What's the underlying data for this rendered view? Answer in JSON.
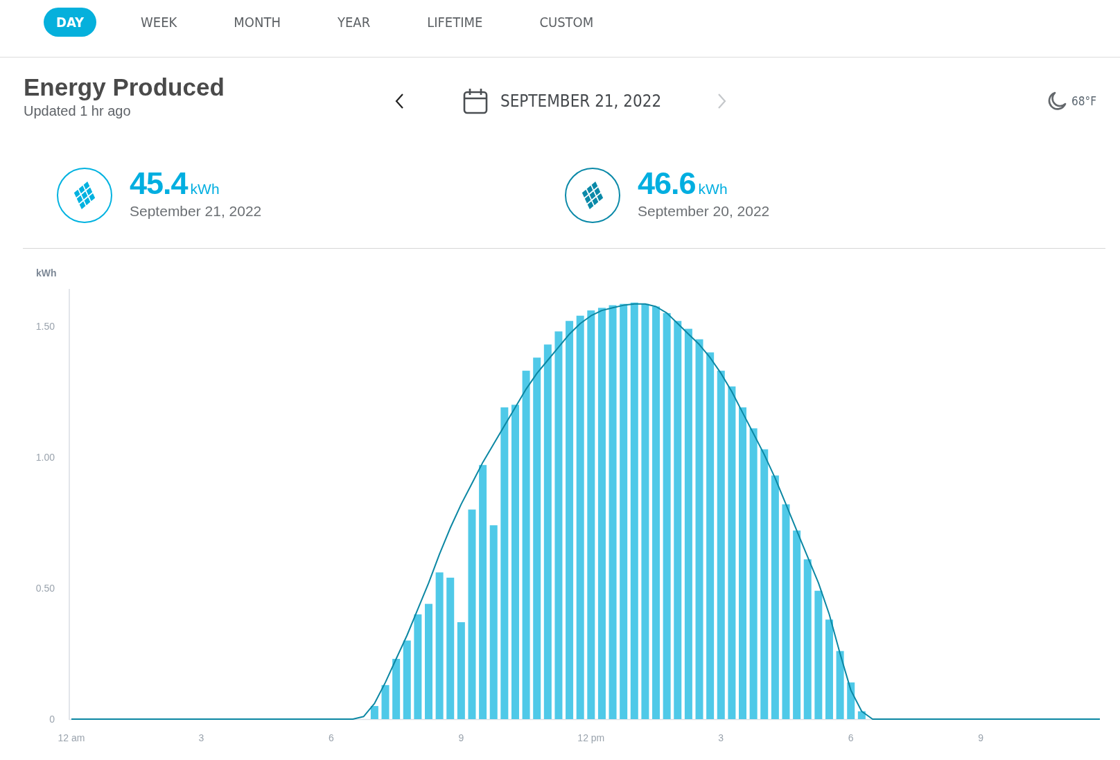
{
  "tabs": [
    {
      "label": "DAY",
      "selected": true
    },
    {
      "label": "WEEK",
      "selected": false
    },
    {
      "label": "MONTH",
      "selected": false
    },
    {
      "label": "YEAR",
      "selected": false
    },
    {
      "label": "LIFETIME",
      "selected": false
    },
    {
      "label": "CUSTOM",
      "selected": false
    }
  ],
  "header": {
    "title": "Energy Produced",
    "updated": "Updated 1 hr ago",
    "date": "SEPTEMBER 21, 2022",
    "previous": {
      "disabled": false
    },
    "next": {
      "disabled": true
    },
    "weather": "68°F"
  },
  "stats": [
    {
      "value": "45.4",
      "unit": "kWh",
      "date": "September 21, 2022",
      "color": "#00b2e0"
    },
    {
      "value": "46.6",
      "unit": "kWh",
      "date": "September 20, 2022",
      "color": "#0a89a8"
    }
  ],
  "chart_data": {
    "type": "bar",
    "ylabel": "kWh",
    "ylim": [
      0,
      1.6
    ],
    "yticks": [
      {
        "value": 0,
        "label": "0"
      },
      {
        "value": 0.5,
        "label": "0.50"
      },
      {
        "value": 1,
        "label": "1.00"
      },
      {
        "value": 1.5,
        "label": "1.50"
      }
    ],
    "categories": [
      "12 am",
      null,
      null,
      null,
      null,
      null,
      null,
      null,
      null,
      null,
      null,
      null,
      "3",
      null,
      null,
      null,
      null,
      null,
      null,
      null,
      null,
      null,
      null,
      null,
      "6",
      null,
      null,
      null,
      null,
      null,
      null,
      null,
      null,
      null,
      null,
      null,
      "9",
      null,
      null,
      null,
      null,
      null,
      null,
      null,
      null,
      null,
      null,
      null,
      "12 pm",
      null,
      null,
      null,
      null,
      null,
      null,
      null,
      null,
      null,
      null,
      null,
      "3",
      null,
      null,
      null,
      null,
      null,
      null,
      null,
      null,
      null,
      null,
      null,
      "6",
      null,
      null,
      null,
      null,
      null,
      null,
      null,
      null,
      null,
      null,
      null,
      "9",
      null,
      null,
      null,
      null,
      null,
      null,
      null,
      null,
      null,
      null,
      null
    ],
    "series": [
      {
        "type": "bar",
        "color": "#4fc9e8",
        "values": [
          0,
          0,
          0,
          0,
          0,
          0,
          0,
          0,
          0,
          0,
          0,
          0,
          0,
          0,
          0,
          0,
          0,
          0,
          0,
          0,
          0,
          0,
          0,
          0,
          0,
          0,
          0,
          0,
          0.05,
          0.13,
          0.23,
          0.3,
          0.4,
          0.44,
          0.56,
          0.54,
          0.37,
          0.8,
          0.97,
          0.74,
          1.19,
          1.2,
          1.33,
          1.38,
          1.43,
          1.48,
          1.52,
          1.54,
          1.56,
          1.57,
          1.58,
          1.585,
          1.59,
          1.585,
          1.575,
          1.55,
          1.52,
          1.49,
          1.45,
          1.4,
          1.33,
          1.27,
          1.19,
          1.11,
          1.03,
          0.93,
          0.82,
          0.72,
          0.61,
          0.49,
          0.38,
          0.26,
          0.14,
          0.03,
          0,
          0,
          0,
          0,
          0,
          0,
          0,
          0,
          0,
          0,
          0,
          0,
          0,
          0,
          0,
          0,
          0,
          0,
          0,
          0,
          0,
          0
        ]
      },
      {
        "type": "line",
        "color": "#0b87a3",
        "values": [
          0,
          0,
          0,
          0,
          0,
          0,
          0,
          0,
          0,
          0,
          0,
          0,
          0,
          0,
          0,
          0,
          0,
          0,
          0,
          0,
          0,
          0,
          0,
          0,
          0,
          0,
          0,
          0.01,
          0.06,
          0.14,
          0.23,
          0.32,
          0.42,
          0.52,
          0.63,
          0.73,
          0.82,
          0.9,
          0.98,
          1.05,
          1.12,
          1.19,
          1.26,
          1.32,
          1.37,
          1.42,
          1.47,
          1.51,
          1.54,
          1.56,
          1.57,
          1.58,
          1.585,
          1.585,
          1.575,
          1.55,
          1.51,
          1.47,
          1.43,
          1.38,
          1.32,
          1.25,
          1.17,
          1.09,
          1.01,
          0.92,
          0.82,
          0.72,
          0.62,
          0.52,
          0.4,
          0.25,
          0.11,
          0.03,
          0,
          0,
          0,
          0,
          0,
          0,
          0,
          0,
          0,
          0,
          0,
          0,
          0,
          0,
          0,
          0,
          0,
          0,
          0,
          0,
          0,
          0
        ]
      }
    ]
  }
}
